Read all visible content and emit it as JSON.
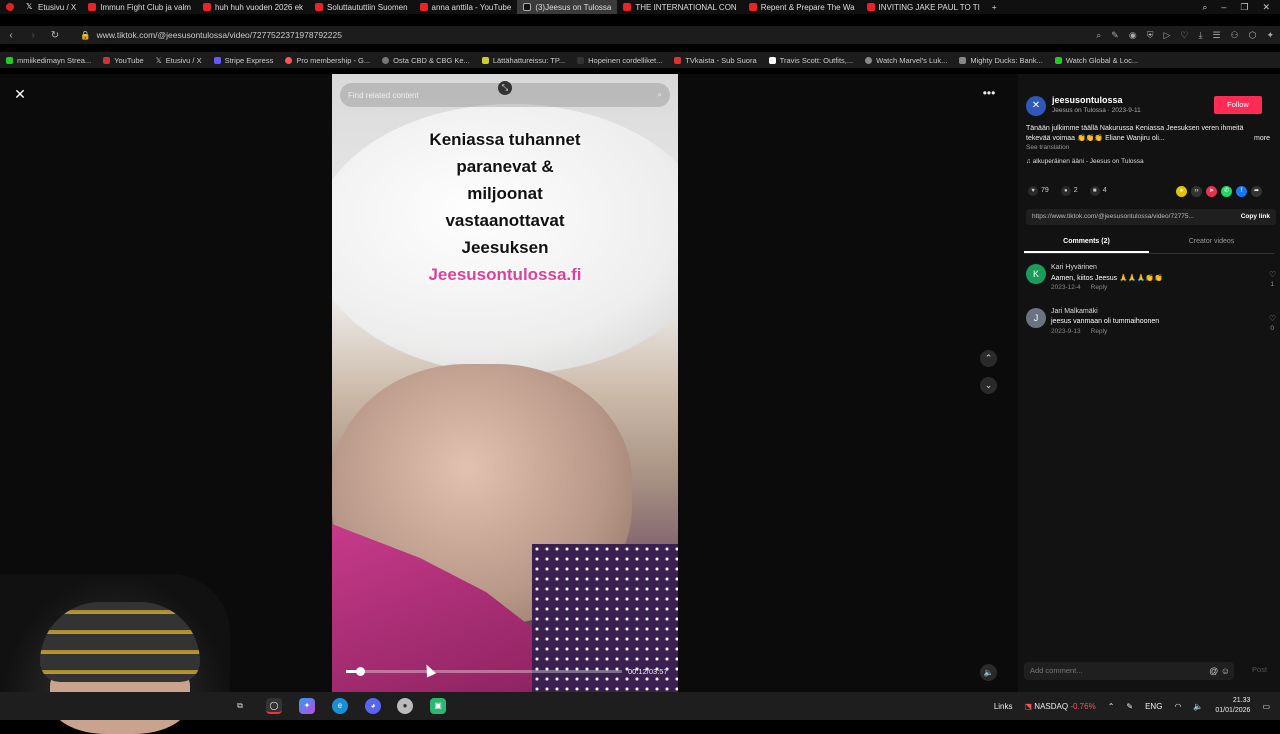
{
  "tabs": [
    {
      "label": "Etusivu / X",
      "icon": "x-logo-icon",
      "active": false
    },
    {
      "label": "Immun Fight Club ja valm",
      "icon": "youtube-icon",
      "active": false
    },
    {
      "label": "huh huh vuoden 2026 ek",
      "icon": "youtube-icon",
      "active": false
    },
    {
      "label": "Soluttaututtiin Suomen",
      "icon": "youtube-icon",
      "active": false
    },
    {
      "label": "anna anttila - YouTube",
      "icon": "youtube-icon",
      "active": false
    },
    {
      "label": "(3)Jeesus on Tulossa",
      "icon": "tiktok-icon",
      "active": true
    },
    {
      "label": "THE INTERNATIONAL CON",
      "icon": "youtube-icon",
      "active": false
    },
    {
      "label": "Repent & Prepare The Wa",
      "icon": "youtube-icon",
      "active": false
    },
    {
      "label": "INVITING JAKE PAUL TO TI",
      "icon": "youtube-icon",
      "active": false
    }
  ],
  "address": {
    "url": "www.tiktok.com/@jeesusontulossa/video/7277522371978792225"
  },
  "bookmarks": [
    "mmiikedimayn Strea...",
    "YouTube",
    "Etusivu / X",
    "Stripe Express",
    "Pro membership - G...",
    "Osta CBD & CBG Ke...",
    "Lättähattureissu: TP...",
    "Hopeinen cordelliket...",
    "TVkaista - Sub Suora",
    "Travis Scott: Outfits,...",
    "Watch Marvel's Luk...",
    "Mighty Ducks: Bank...",
    "Watch Global & Loc..."
  ],
  "video": {
    "search_placeholder": "Find related content",
    "overlay_lines": [
      "Keniassa tuhannet",
      "paranevat &",
      "miljoonat",
      "vastaanottavat",
      "Jeesuksen"
    ],
    "overlay_link": "Jeesusontulossa.fi",
    "timecode": "00:12/03:57",
    "progress_fraction": 0.05
  },
  "panel": {
    "account_name": "jeesusontulossa",
    "account_sub": "Jeesus on Tulossa · 2023-9-11",
    "follow_label": "Follow",
    "description": "Tänään julkimme täällä Nakurussa Keniassa Jeesuksen veren ihmeitä tekevää voimaa 👏👏👏 Eliane Wanjiru oli...",
    "more_label": "more",
    "see_translation": "See translation",
    "sound": "♫ alkuperäinen ääni - Jeesus on Tulossa",
    "likes": "79",
    "comments": "2",
    "saves": "4",
    "link": "https://www.tiktok.com/@jeesusontulossa/video/72775...",
    "copy_link": "Copy link",
    "tab_comments": "Comments (2)",
    "tab_creator": "Creator videos",
    "comment_list": [
      {
        "initial": "K",
        "name": "Kari Hyvärinen",
        "text": "Aamen, kiitos Jeesus 🙏🙏🙏👏👏",
        "date": "2023-12-4",
        "reply": "Reply",
        "likes": "1"
      },
      {
        "initial": "J",
        "name": "Jari Malkamäki",
        "text": "jeesus vanmaan oli tummaihoonen",
        "date": "2023-9-13",
        "reply": "Reply",
        "likes": "0"
      }
    ],
    "add_comment_placeholder": "Add comment...",
    "post_label": "Post"
  },
  "taskbar": {
    "links_label": "Links",
    "stock_label": "NASDAQ",
    "stock_change": "-0.76%",
    "language": "ENG",
    "time": "21.33",
    "date": "01/01/2026"
  }
}
